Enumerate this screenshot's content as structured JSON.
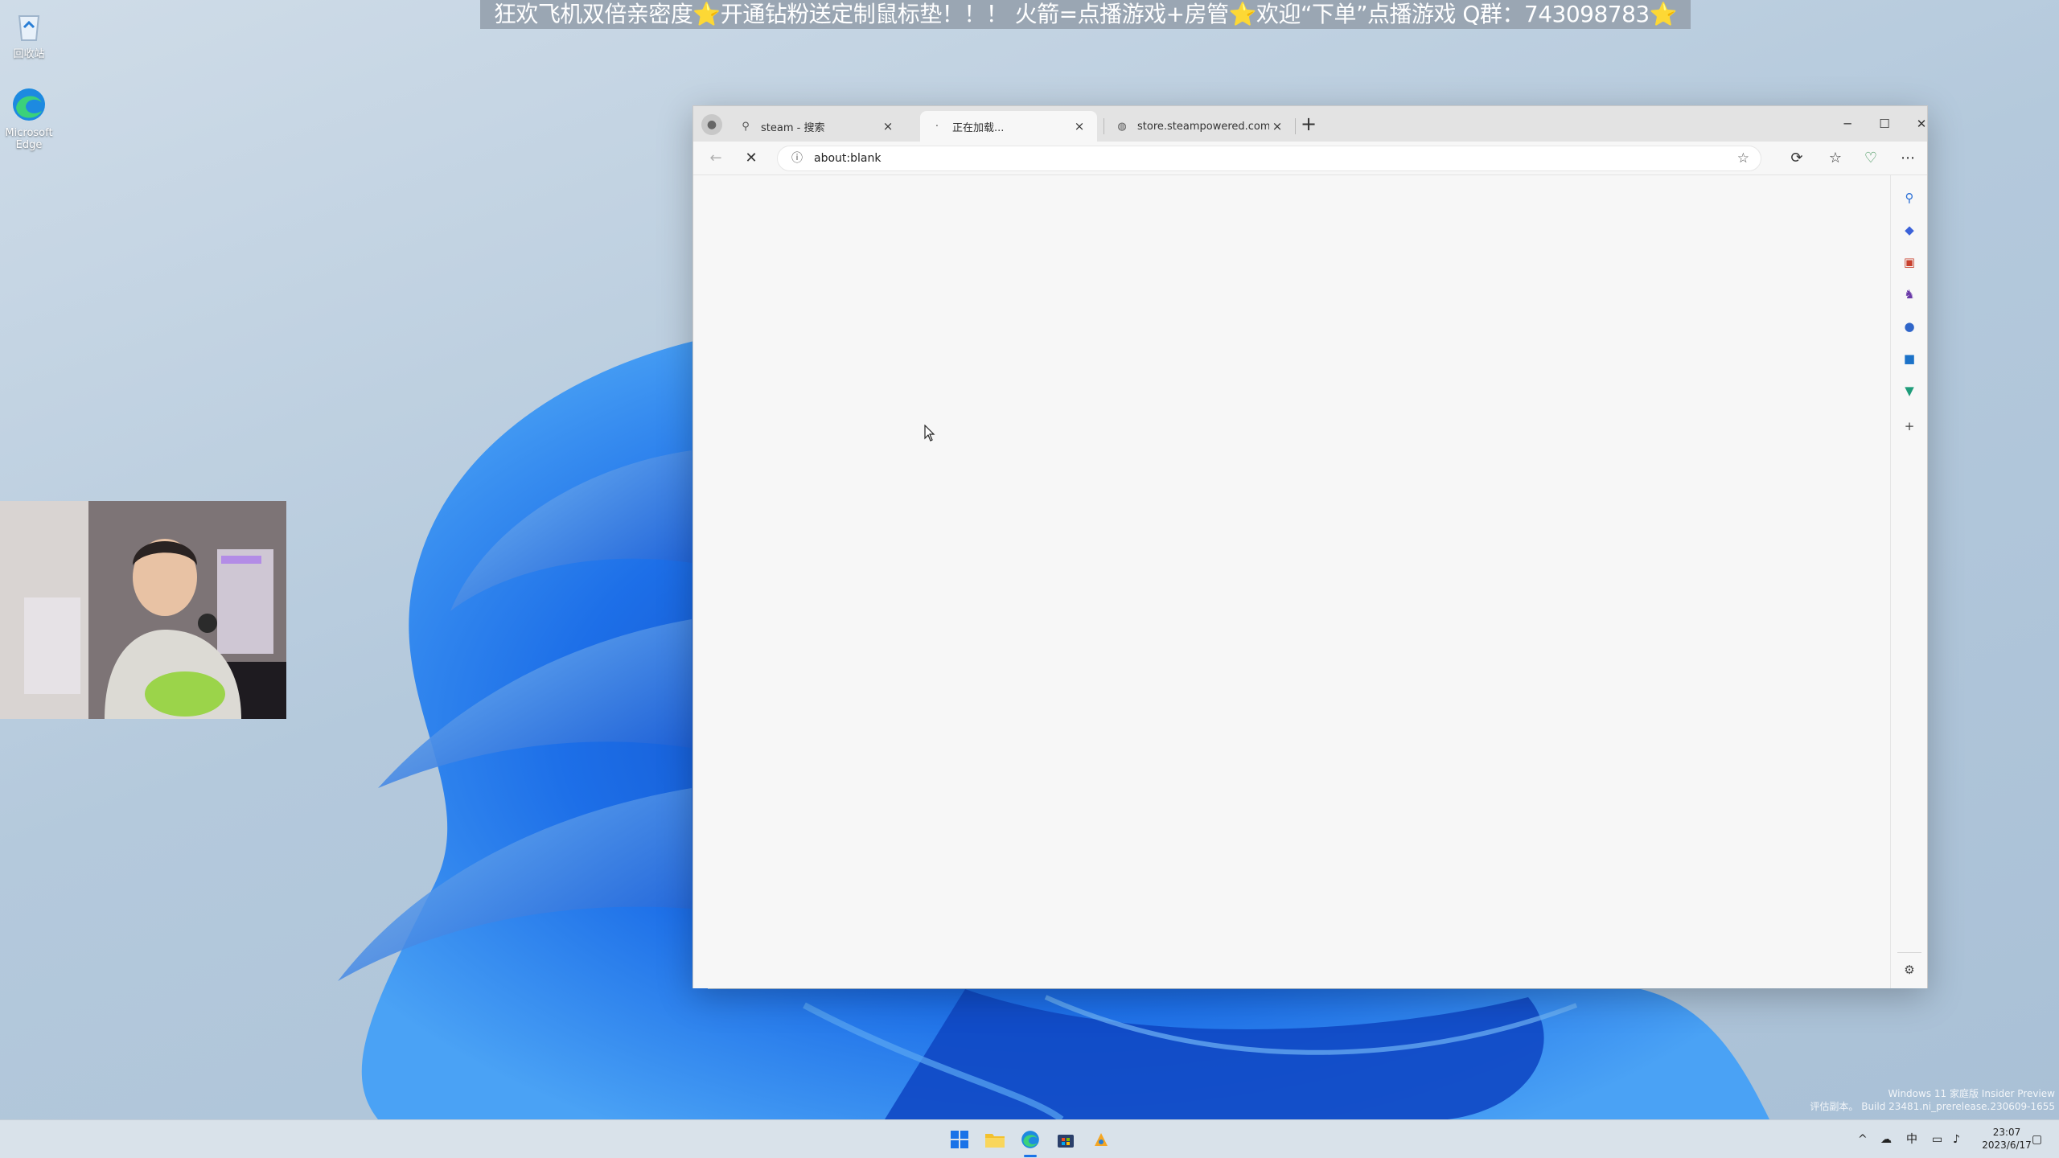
{
  "banner": {
    "text": "狂欢飞机双倍亲密度⭐开通钻粉送定制鼠标垫！！！ 火箭=点播游戏+房管⭐欢迎“下单”点播游戏  Q群：743098783⭐"
  },
  "desktop": {
    "icons": [
      {
        "label": "回收站",
        "icon": "recycle-bin-icon"
      },
      {
        "label": "Microsoft Edge",
        "icon": "edge-icon"
      }
    ]
  },
  "browser": {
    "tabs": [
      {
        "label": "steam - 搜索",
        "icon": "search-icon",
        "active": false
      },
      {
        "label": "正在加载...",
        "icon": "loading-icon",
        "active": true
      },
      {
        "label": "store.steampowered.com",
        "icon": "steam-icon",
        "active": false
      }
    ],
    "new_tab_label": "+",
    "window_buttons": {
      "minimize": "─",
      "maximize": "☐",
      "close": "✕"
    },
    "address": {
      "url": "about:blank"
    },
    "toolbar_icons": [
      "back-icon",
      "stop-icon",
      "info-icon",
      "favorite-star-icon",
      "extensions-icon",
      "favorites-icon",
      "browser-essentials-icon",
      "more-icon"
    ],
    "sidebar_icons": [
      {
        "name": "search-icon",
        "color": "#2a6fd6"
      },
      {
        "name": "shopping-tag-icon",
        "color": "#3b62d9"
      },
      {
        "name": "tools-icon",
        "color": "#c8412e"
      },
      {
        "name": "games-icon",
        "color": "#6a3aa8"
      },
      {
        "name": "microsoft-365-icon",
        "color": "#3066c9"
      },
      {
        "name": "outlook-icon",
        "color": "#1c72c8"
      },
      {
        "name": "drop-icon",
        "color": "#1e9c7a"
      },
      {
        "name": "add-icon",
        "color": "#444444"
      },
      {
        "name": "settings-icon",
        "color": "#444444"
      }
    ]
  },
  "watermark": {
    "line1": "Windows 11 家庭版 Insider Preview",
    "line2": "评估副本。 Build 23481.ni_prerelease.230609-1655"
  },
  "taskbar": {
    "apps": [
      "start-icon",
      "file-explorer-icon",
      "edge-icon",
      "store-icon",
      "live-app-icon"
    ],
    "tray": {
      "chevron": "^",
      "lang": "中"
    },
    "time": "23:07",
    "date": "2023/6/17"
  }
}
